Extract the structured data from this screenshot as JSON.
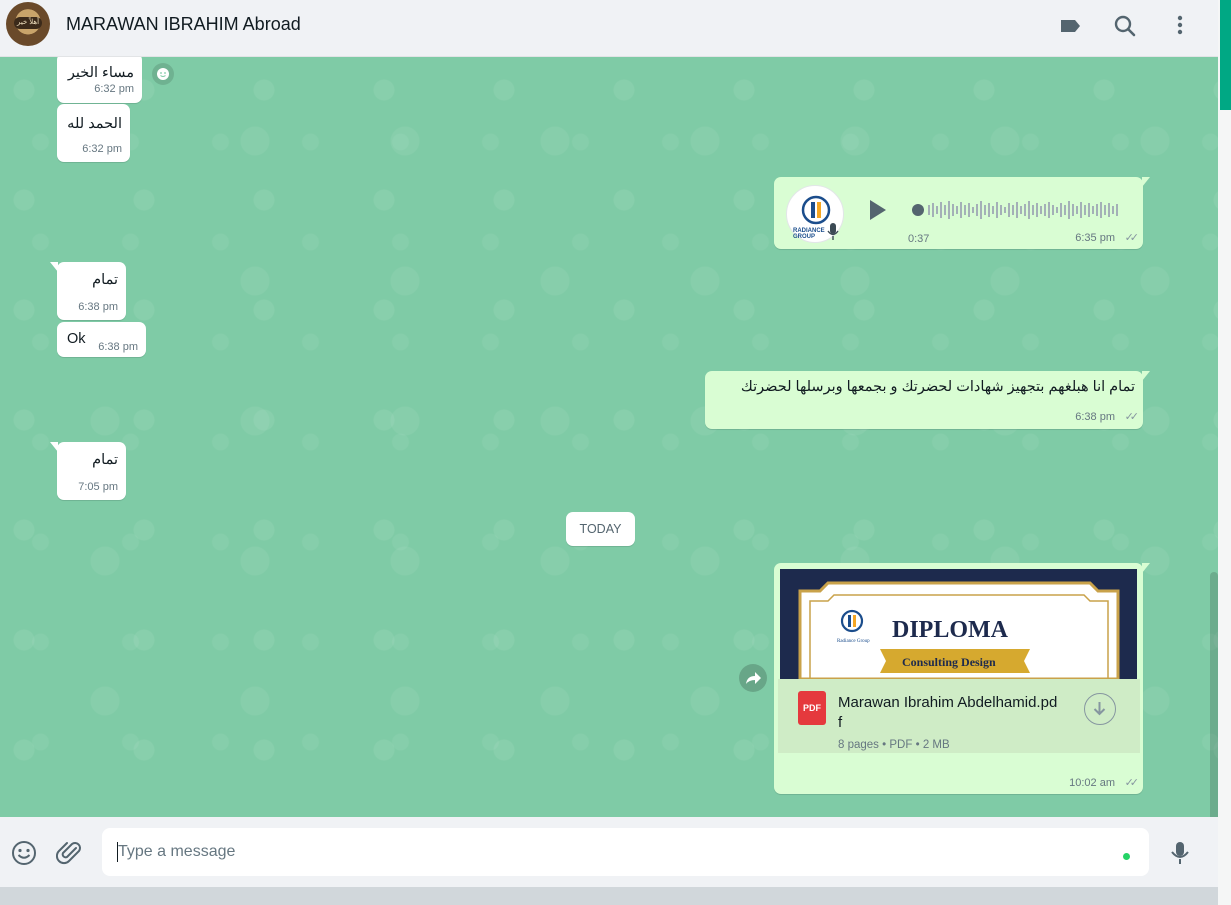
{
  "header": {
    "contact_name": "MARAWAN IBRAHIM Abroad",
    "avatar_text": "أهلاً خير",
    "icons": [
      "label-icon",
      "search-icon",
      "more-vertical-icon"
    ]
  },
  "messages": [
    {
      "id": "m1",
      "direction": "incoming",
      "text": "مساء الخير",
      "time": "6:32 pm"
    },
    {
      "id": "m2",
      "direction": "incoming",
      "text": "الحمد لله",
      "time": "6:32 pm"
    },
    {
      "id": "m3",
      "direction": "outgoing",
      "type": "voice",
      "duration": "0:37",
      "time": "6:35 pm",
      "sender_logo_text": "RADIANCE GROUP"
    },
    {
      "id": "m4",
      "direction": "incoming",
      "text": "تمام",
      "time": "6:38 pm"
    },
    {
      "id": "m5",
      "direction": "incoming",
      "text": "Ok",
      "time": "6:38 pm"
    },
    {
      "id": "m6",
      "direction": "outgoing",
      "text": "تمام انا هبلغهم بتجهيز شهادات لحضرتك و بجمعها وبرسلها لحضرتك",
      "time": "6:38 pm"
    },
    {
      "id": "m7",
      "direction": "incoming",
      "text": "تمام",
      "time": "7:05 pm"
    },
    {
      "id": "m8",
      "direction": "outgoing",
      "type": "document",
      "preview_title": "DIPLOMA",
      "preview_subtitle": "Consulting Design",
      "preview_org": "Radiance Group",
      "file_name_line1": "Marawan Ibrahim Abdelhamid.pd",
      "file_name_line2": "f",
      "pages": "8 pages",
      "file_type": "PDF",
      "size": "2 MB",
      "icon_label": "PDF",
      "time": "10:02 am"
    }
  ],
  "date_divider": "TODAY",
  "composer": {
    "placeholder": "Type a message",
    "icons": [
      "emoji-icon",
      "attach-icon",
      "mic-icon"
    ]
  },
  "colors": {
    "chat_bg": "#7fcba6",
    "outgoing_bubble": "#d9fdd3",
    "incoming_bubble": "#ffffff",
    "accent": "#00a884"
  }
}
